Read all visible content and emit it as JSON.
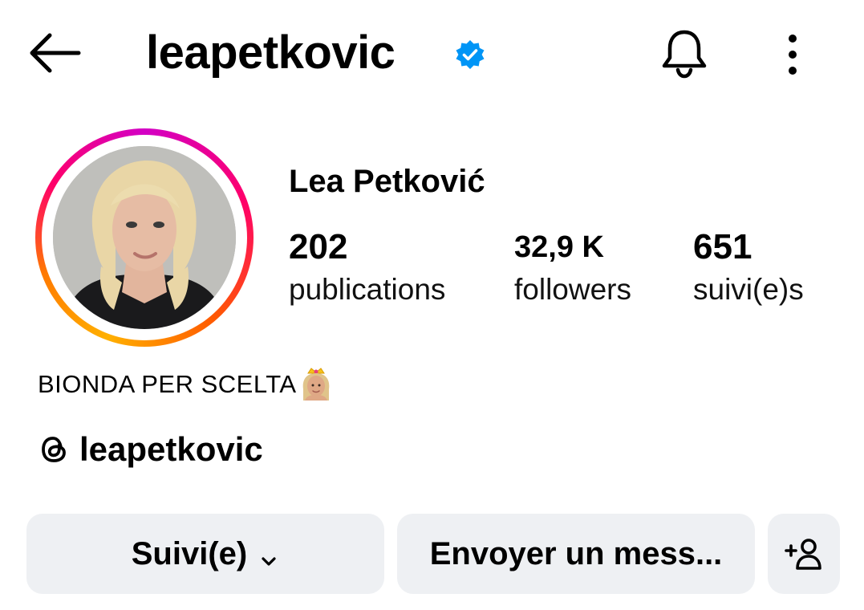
{
  "header": {
    "username": "leapetkovic",
    "icons": [
      "back-arrow-icon",
      "verified-badge-icon",
      "bell-icon",
      "more-vertical-icon"
    ]
  },
  "profile": {
    "full_name": "Lea Petković",
    "avatar": "profile-photo"
  },
  "stats": [
    {
      "value": "202",
      "label": "publications"
    },
    {
      "value": "32,9 K",
      "label": "followers"
    },
    {
      "value": "651",
      "label": "suivi(e)s"
    }
  ],
  "bio": {
    "text": "BIONDA PER SCELTA",
    "emoji": "princess-emoji"
  },
  "threads": {
    "handle": "leapetkovic",
    "icon": "threads-icon"
  },
  "actions": {
    "follow_label": "Suivi(e)",
    "message_label": "Envoyer un mess...",
    "add_user_icon": "add-person-icon"
  },
  "colors": {
    "verified": "#0095f6",
    "button_bg": "#eef0f3",
    "story_ring": [
      "#d300c5",
      "#ff0069",
      "#ff5a00",
      "#ffb000"
    ]
  }
}
